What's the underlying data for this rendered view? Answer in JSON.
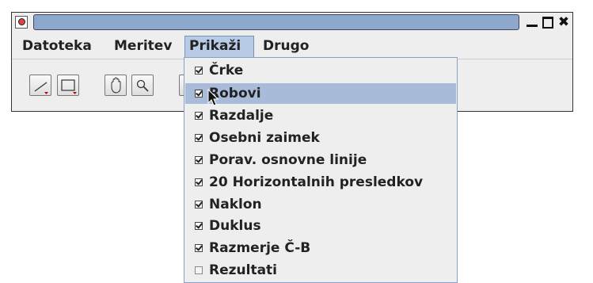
{
  "window": {
    "title": ""
  },
  "menubar": {
    "items": [
      {
        "label": "Datoteka"
      },
      {
        "label": "Meritev"
      },
      {
        "label": "Prikaži"
      },
      {
        "label": "Drugo"
      }
    ]
  },
  "toolbar": {
    "buttons": [
      {
        "icon": "line-tool-icon"
      },
      {
        "icon": "rectangle-tool-icon"
      },
      {
        "icon": "hand-pan-icon"
      },
      {
        "icon": "magnifier-icon"
      }
    ]
  },
  "dropdown": {
    "items": [
      {
        "label": "Črke",
        "checked": true
      },
      {
        "label": "Robovi",
        "checked": true,
        "hover": true
      },
      {
        "label": "Razdalje",
        "checked": true
      },
      {
        "label": "Osebni zaimek",
        "checked": true
      },
      {
        "label": "Porav. osnovne linije",
        "checked": true
      },
      {
        "label": "20 Horizontalnih presledkov",
        "checked": true
      },
      {
        "label": "Naklon",
        "checked": true
      },
      {
        "label": "Duklus",
        "checked": true
      },
      {
        "label": "Razmerje Č-B",
        "checked": true
      },
      {
        "label": "Rezultati",
        "checked": false
      }
    ]
  },
  "colors": {
    "title_field": "#8ea7cc",
    "menu_active": "#b8cbe6",
    "item_hover": "#a8bbd8",
    "window_bg": "#eeeeee"
  }
}
